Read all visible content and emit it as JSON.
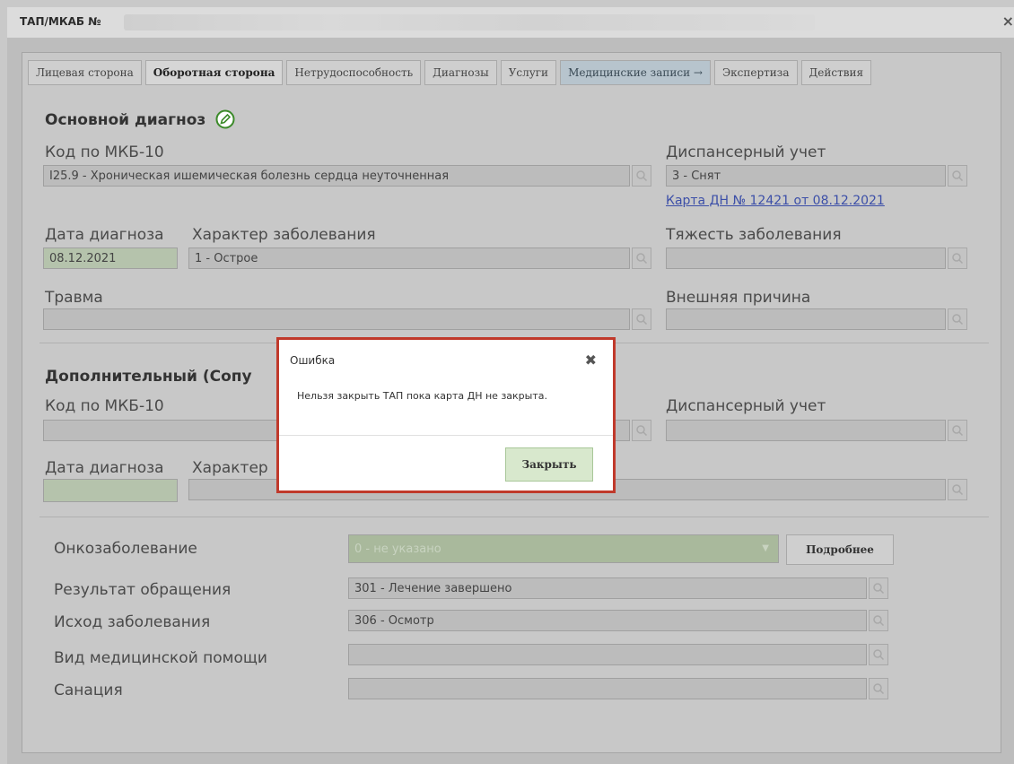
{
  "window": {
    "title": "ТАП/МКАБ №",
    "close_icon": "×"
  },
  "tabs": [
    {
      "label": "Лицевая сторона"
    },
    {
      "label": "Оборотная сторона"
    },
    {
      "label": "Нетрудоспособность"
    },
    {
      "label": "Диагнозы"
    },
    {
      "label": "Услуги"
    },
    {
      "label": "Медицинские записи →"
    },
    {
      "label": "Экспертиза"
    },
    {
      "label": "Действия"
    }
  ],
  "main_diagnosis": {
    "heading": "Основной диагноз",
    "mkb_label": "Код по МКБ-10",
    "mkb_value": "I25.9 - Хроническая ишемическая болезнь сердца неуточненная",
    "disp_label": "Диспансерный учет",
    "disp_value": "3 - Снят",
    "card_link": "Карта ДН № 12421 от 08.12.2021",
    "date_label": "Дата диагноза",
    "date_value": "08.12.2021",
    "character_label": "Характер заболевания",
    "character_value": "1 - Острое",
    "severity_label": "Тяжесть заболевания",
    "severity_value": "",
    "injury_label": "Травма",
    "injury_value": "",
    "external_label": "Внешняя причина",
    "external_value": ""
  },
  "additional_diagnosis": {
    "heading": "Дополнительный (Сопу",
    "mkb_label": "Код по МКБ-10",
    "disp_label": "Диспансерный учет",
    "date_label": "Дата диагноза",
    "character_label": "Характер"
  },
  "outcome": {
    "onco_label": "Онкозаболевание",
    "onco_value": "0 - не указано",
    "more_button": "Подробнее",
    "result_label": "Результат обращения",
    "result_value": "301 - Лечение завершено",
    "exodus_label": "Исход заболевания",
    "exodus_value": "306 - Осмотр",
    "care_type_label": "Вид медицинской помощи",
    "care_type_value": "",
    "sanation_label": "Санация",
    "sanation_value": ""
  },
  "dialog": {
    "title": "Ошибка",
    "close_icon": "✖",
    "message": "Нельзя закрыть ТАП пока карта ДН не закрыта.",
    "close_button": "Закрыть"
  }
}
